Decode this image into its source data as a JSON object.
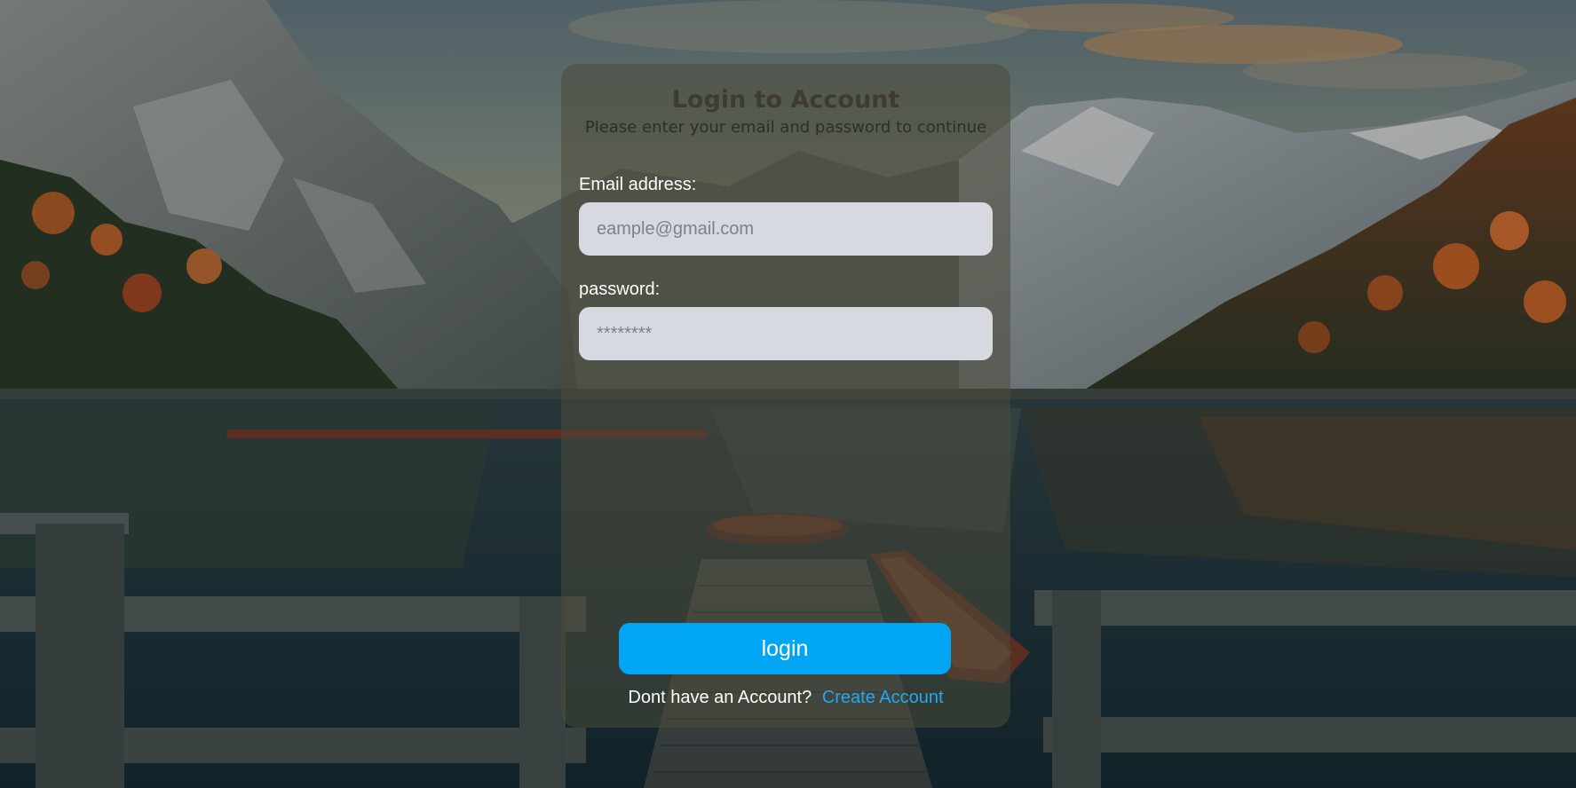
{
  "login_card": {
    "title": "Login to Account",
    "subtitle": "Please enter your email and password to continue",
    "email": {
      "label": "Email address:",
      "placeholder": "eample@gmail.com",
      "value": ""
    },
    "password": {
      "label": "password:",
      "placeholder": "********",
      "value": ""
    },
    "login_button": "login",
    "signup_prompt": "Dont have an Account?",
    "signup_link": "Create Account"
  },
  "colors": {
    "accent": "#00a5f3",
    "link": "#23a8f2",
    "card_overlay": "rgba(74,74,58,0.55)",
    "input_bg": "#d6d9e0"
  },
  "background": {
    "description_icon": "mountain-lake-landscape"
  }
}
